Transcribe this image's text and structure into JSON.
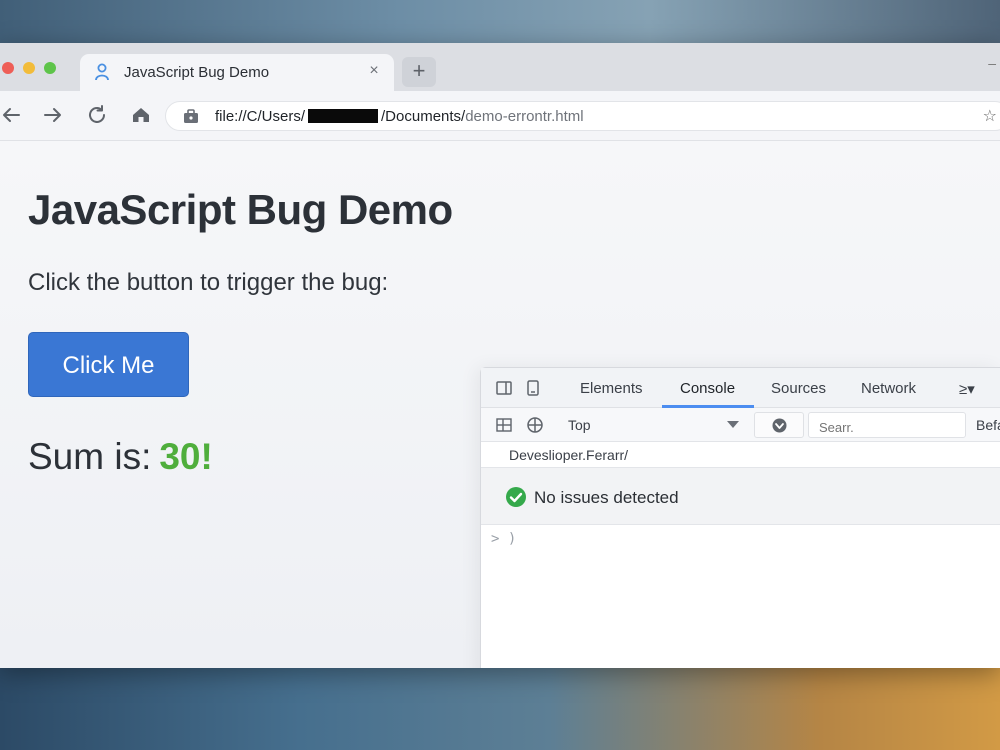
{
  "browser": {
    "tab_title": "JavaScript Bug Demo",
    "tab_close_glyph": "×",
    "new_tab_glyph": "+",
    "minimize_glyph": "–",
    "url_prefix": "file://C/Users/",
    "url_middle": "/Documents/",
    "url_file": "demo-errontr.html",
    "bookmark_glyph": "☆"
  },
  "page": {
    "title": "JavaScript Bug Demo",
    "instruction": "Click the button to trigger the bug:",
    "button_label": "Click Me",
    "sum_label": "Sum is:",
    "sum_value": "30!"
  },
  "devtools": {
    "tabs": [
      "Elements",
      "Console",
      "Sources",
      "Network"
    ],
    "more_tabs_glyph": "≥▾",
    "active_tab": "Console",
    "context": "Top",
    "search_placeholder": "Searr.",
    "default_levels": "Befa",
    "breadcrumb": "Deveslioper.Ferarr/",
    "issues_text": "No issues detected",
    "prompt": "> )"
  },
  "colors": {
    "accent_button": "#3a77d4",
    "sum_green": "#4fae3c",
    "devtools_underline": "#4c8df0",
    "check_green": "#35a94b"
  }
}
